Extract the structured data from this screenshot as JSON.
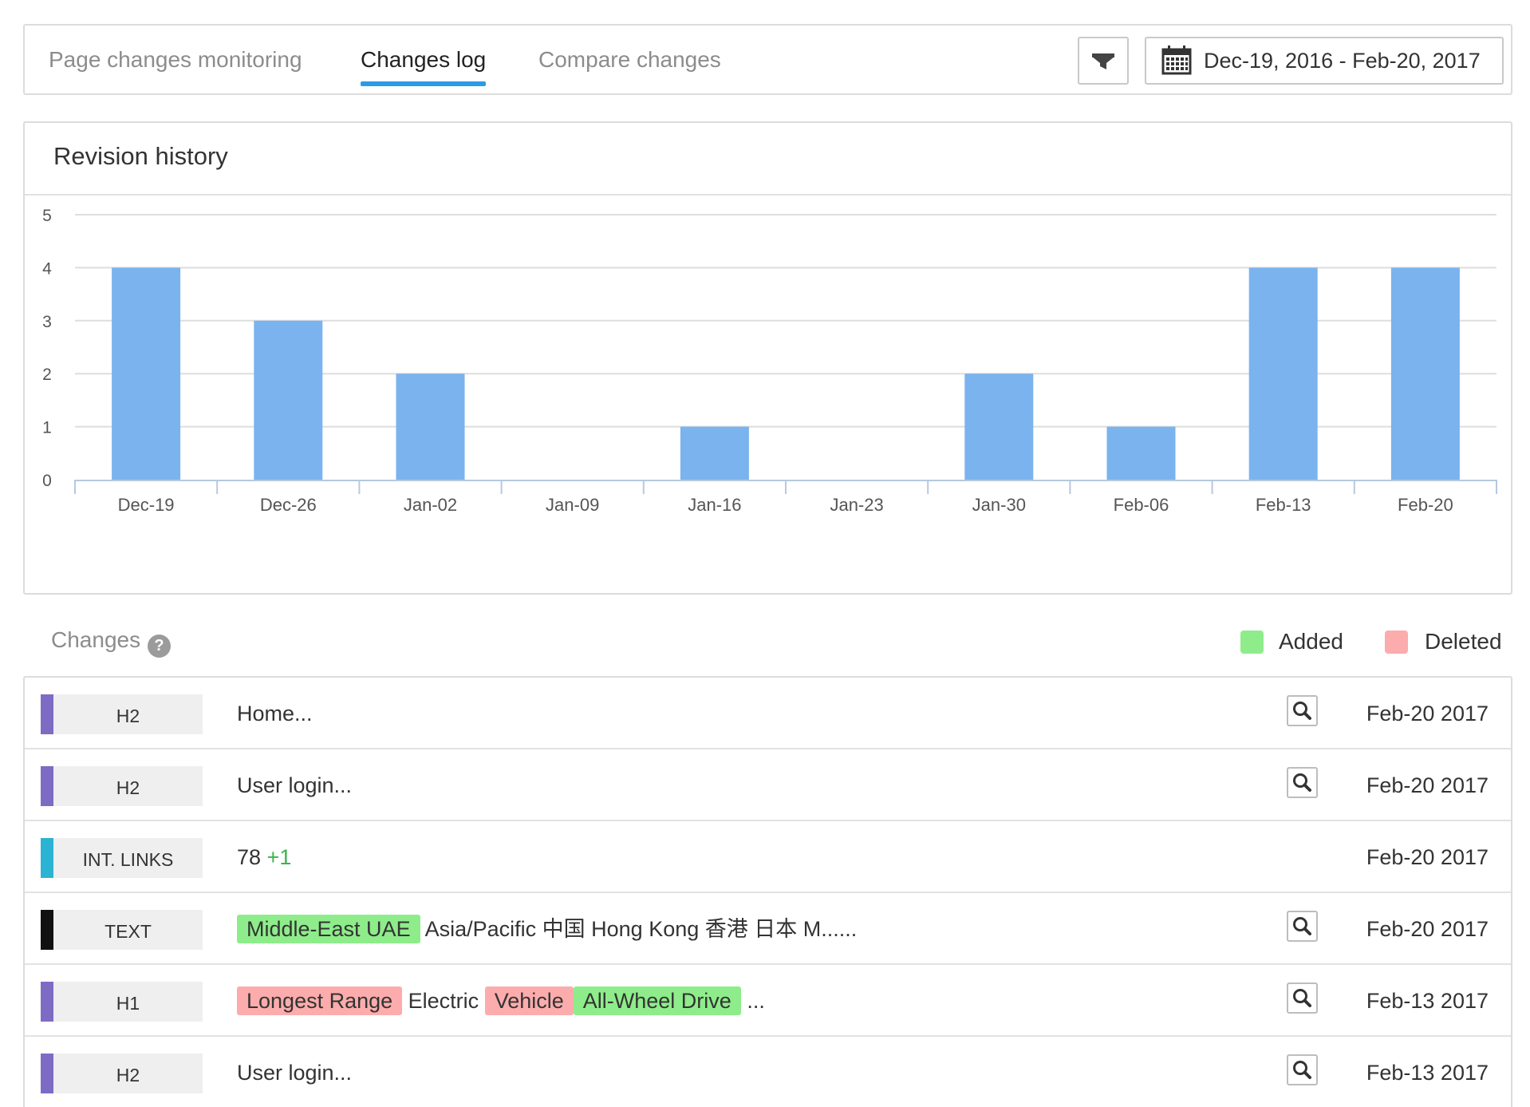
{
  "tabs": [
    {
      "label": "Page changes monitoring",
      "active": false
    },
    {
      "label": "Changes log",
      "active": true
    },
    {
      "label": "Compare changes",
      "active": false
    }
  ],
  "toolbar": {
    "filter_icon": "funnel-icon",
    "calendar_icon": "calendar-icon",
    "date_range": "Dec-19, 2016 - Feb-20, 2017"
  },
  "revision_history": {
    "title": "Revision history"
  },
  "chart_data": {
    "type": "bar",
    "title": "Revision history",
    "categories": [
      "Dec-19",
      "Dec-26",
      "Jan-02",
      "Jan-09",
      "Jan-16",
      "Jan-23",
      "Jan-30",
      "Feb-06",
      "Feb-13",
      "Feb-20"
    ],
    "values": [
      4,
      3,
      2,
      0,
      1,
      0,
      2,
      1,
      4,
      4
    ],
    "ylim": [
      0,
      5
    ],
    "yticks": [
      "0",
      "1",
      "2",
      "3",
      "4",
      "5"
    ],
    "grid": true,
    "bar_color": "#7ab3ee",
    "xlabel": "",
    "ylabel": ""
  },
  "changes": {
    "label": "Changes",
    "help_icon": "question-circle-icon",
    "legend": [
      {
        "label": "Added",
        "color": "#8eed8a"
      },
      {
        "label": "Deleted",
        "color": "#fcacac"
      }
    ],
    "rows": [
      {
        "tag": "H2",
        "tag_color": "#7e6bc4",
        "segments": [
          {
            "text": "Home...",
            "type": "plain"
          }
        ],
        "has_zoom": true,
        "date": "Feb-20 2017"
      },
      {
        "tag": "H2",
        "tag_color": "#7e6bc4",
        "segments": [
          {
            "text": "User login...",
            "type": "plain"
          }
        ],
        "has_zoom": true,
        "date": "Feb-20 2017"
      },
      {
        "tag": "INT. LINKS",
        "tag_color": "#2bb3d4",
        "segments": [
          {
            "text": "78 ",
            "type": "plain"
          },
          {
            "text": "+1",
            "type": "delta"
          }
        ],
        "has_zoom": false,
        "date": "Feb-20 2017"
      },
      {
        "tag": "TEXT",
        "tag_color": "#111111",
        "segments": [
          {
            "text": "Middle-East UAE",
            "type": "added"
          },
          {
            "text": " Asia/Pacific 中国 Hong Kong 香港 日本 M......",
            "type": "plain"
          }
        ],
        "has_zoom": true,
        "date": "Feb-20 2017"
      },
      {
        "tag": "H1",
        "tag_color": "#7e6bc4",
        "segments": [
          {
            "text": "Longest Range",
            "type": "deleted"
          },
          {
            "text": " Electric ",
            "type": "plain"
          },
          {
            "text": "Vehicle",
            "type": "deleted"
          },
          {
            "text": "All-Wheel Drive",
            "type": "added"
          },
          {
            "text": " ...",
            "type": "plain"
          }
        ],
        "has_zoom": true,
        "date": "Feb-13 2017"
      },
      {
        "tag": "H2",
        "tag_color": "#7e6bc4",
        "segments": [
          {
            "text": "User login...",
            "type": "plain"
          }
        ],
        "has_zoom": true,
        "date": "Feb-13 2017"
      }
    ]
  }
}
